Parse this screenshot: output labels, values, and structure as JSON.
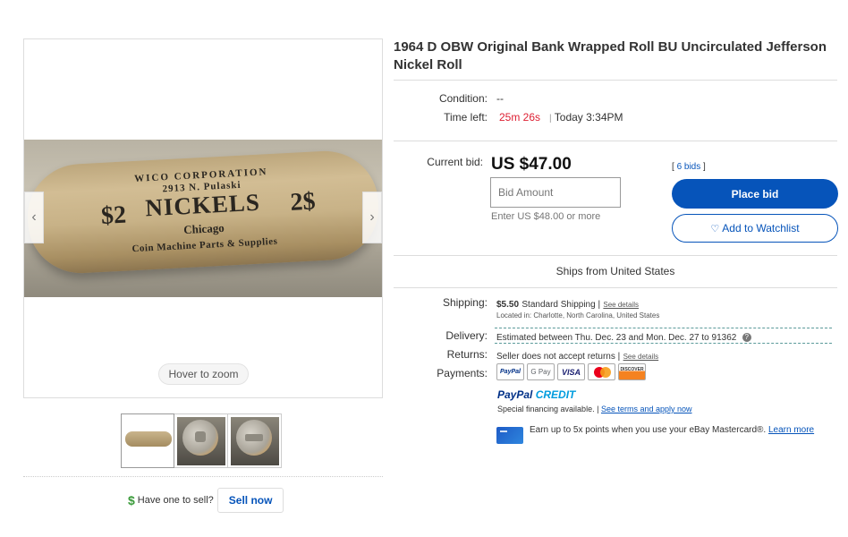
{
  "gallery": {
    "roll_print": {
      "line1": "WICO CORPORATION",
      "line2": "2913 N. Pulaski",
      "nickels": "NICKELS",
      "denom_left": "$2",
      "denom_right": "2$",
      "city": "Chicago",
      "line5": "Coin Machine Parts & Supplies"
    },
    "prev_glyph": "‹",
    "next_glyph": "›",
    "hover_zoom": "Hover to zoom"
  },
  "sell": {
    "icon": "$",
    "question": "Have one to sell?",
    "button": "Sell now"
  },
  "listing": {
    "title": "1964 D OBW Original Bank Wrapped Roll BU Uncirculated Jefferson Nickel Roll",
    "condition_label": "Condition:",
    "condition_value": "--",
    "time_label": "Time left:",
    "time_left": "25m 26s",
    "time_sep": "|",
    "time_end": "Today 3:34PM"
  },
  "bid": {
    "label": "Current bid:",
    "price": "US $47.00",
    "input_placeholder": "Bid Amount",
    "enter_more": "Enter US $48.00 or more",
    "bids_open": "[",
    "bids_count": "6 bids",
    "bids_close": "]",
    "place_bid": "Place bid",
    "watchlist": "Add to Watchlist"
  },
  "shipping": {
    "ships_from": "Ships from United States",
    "shipping_label": "Shipping:",
    "cost": "$5.50",
    "method": "Standard Shipping |",
    "see_details": "See details",
    "located": "Located in:  Charlotte, North Carolina, United States",
    "delivery_label": "Delivery:",
    "delivery": "Estimated between Thu. Dec. 23 and Mon. Dec. 27 to 91362",
    "returns_label": "Returns:",
    "returns": "Seller does not accept returns |",
    "returns_link": "See details",
    "payments_label": "Payments:"
  },
  "payments": {
    "cards": [
      "PayPal",
      "G Pay",
      "VISA",
      "",
      "DISCOVER"
    ],
    "paypal_credit_1": "PayPal",
    "paypal_credit_2": "CREDIT",
    "special": "Special financing available. |",
    "special_link": "See terms and apply now",
    "earn": "Earn up to 5x points when you use your eBay Mastercard®.",
    "learn_more": "Learn more"
  },
  "colors": {
    "primary_blue": "#0654ba",
    "time_red": "#dd1e31"
  }
}
